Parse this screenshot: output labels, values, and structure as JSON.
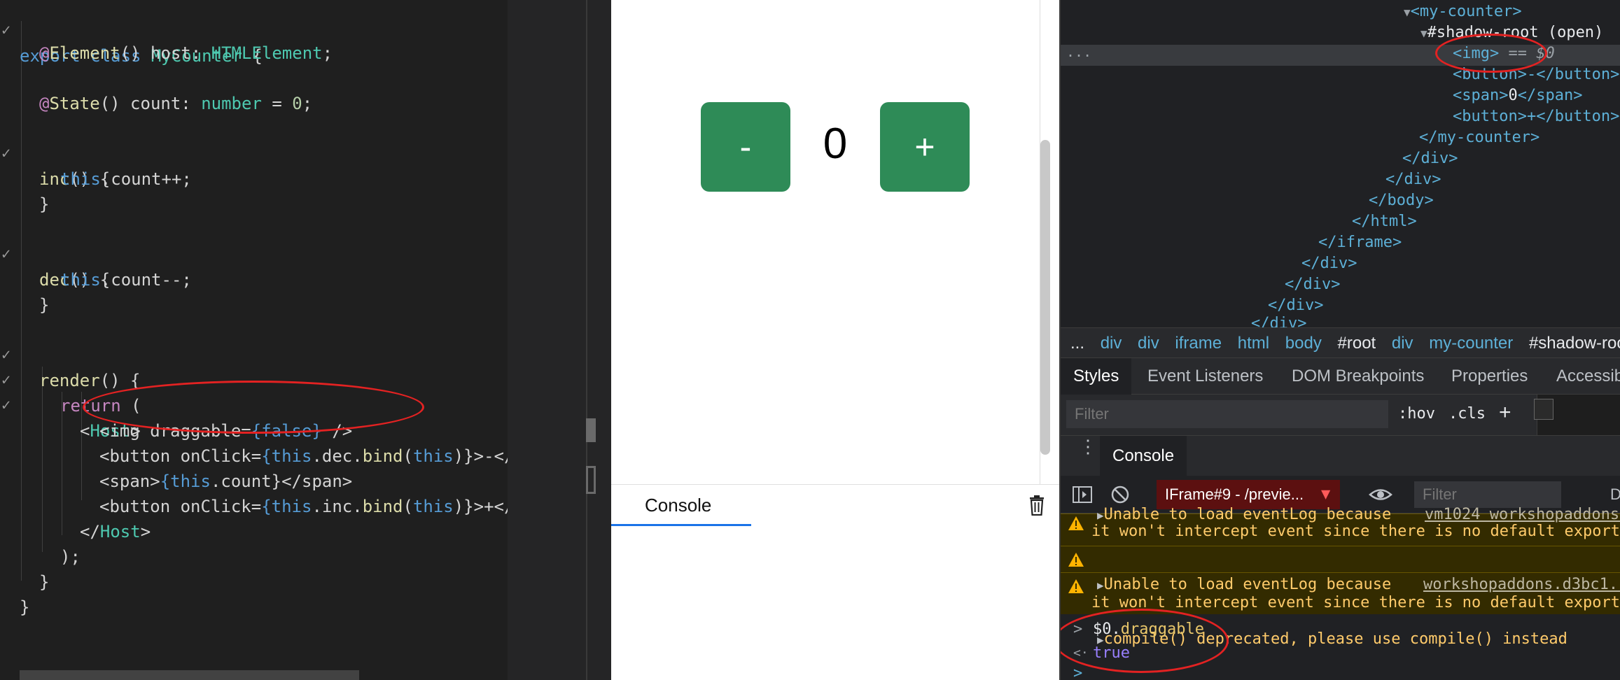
{
  "editor": {
    "lines": {
      "l0_kw": "export class ",
      "l0_cls": "MyCounter",
      "l0_end": " {",
      "l1_at": "@",
      "l1_dec": "Element",
      "l1_rest": "() host: ",
      "l1_type": "HTMLElement",
      "l1_end": ";",
      "l3_at": "@",
      "l3_dec": "State",
      "l3_rest": "() count: ",
      "l3_type": "number",
      "l3_eq": " = ",
      "l3_num": "0",
      "l3_end": ";",
      "l5_fn": "inc",
      "l5_rest": "() {",
      "l6_this": "this",
      "l6_rest": ".count++;",
      "l7": "}",
      "l9_fn": "dec",
      "l9_rest": "() {",
      "l10_this": "this",
      "l10_rest": ".count--;",
      "l11": "}",
      "l13_fn": "render",
      "l13_rest": "() {",
      "l14_kw": "return",
      "l14_rest": " (",
      "l15_open": "<",
      "l15_tag": "Host",
      "l15_close": ">",
      "l16_a": "<img draggable=",
      "l16_b": "{",
      "l16_c": "false",
      "l16_d": "}",
      "l16_e": " />",
      "l17_a": "<button onClick=",
      "l17_b": "{",
      "l17_this": "this",
      "l17_c": ".dec.",
      "l17_bind": "bind",
      "l17_d": "(",
      "l17_this2": "this",
      "l17_e": ")}>-</",
      "l18_a": "<span>",
      "l18_b": "{",
      "l18_this": "this",
      "l18_c": ".count}</span>",
      "l19_a": "<button onClick=",
      "l19_b": "{",
      "l19_this": "this",
      "l19_c": ".inc.",
      "l19_bind": "bind",
      "l19_d": "(",
      "l19_this2": "this",
      "l19_e": ")}>+</",
      "l20_a": "</",
      "l20_tag": "Host",
      "l20_b": ">",
      "l21": ");",
      "l22": "}",
      "l23": "}"
    },
    "fold_marker": "✓"
  },
  "preview": {
    "minus_label": "-",
    "plus_label": "+",
    "count": "0"
  },
  "preview_console": {
    "tab_label": "Console",
    "trash_icon": "trash-icon"
  },
  "devtools": {
    "dom": {
      "my_counter_open": "<my-counter>",
      "shadow_root": "#shadow-root (open)",
      "img_line": "<img>",
      "img_eq": " == ",
      "img_dollar": "$0",
      "button_minus": "<button>-</button>",
      "span_open": "<span>",
      "span_val": "0",
      "span_close": "</span>",
      "button_plus": "<button>+</button>",
      "my_counter_close": "</my-counter>",
      "div_close_1": "</div>",
      "div_close_2": "</div>",
      "body_close": "</body>",
      "html_close": "</html>",
      "iframe_close": "</iframe>",
      "div_close_3": "</div>",
      "div_close_4": "</div>",
      "div_close_5": "</div>",
      "div_close_6": "</div>",
      "dots": "..."
    },
    "breadcrumbs": [
      "...",
      "div",
      "div",
      "iframe",
      "html",
      "body",
      "#root",
      "div",
      "my-counter",
      "#shadow-root"
    ],
    "panel_tabs": [
      "Styles",
      "Event Listeners",
      "DOM Breakpoints",
      "Properties",
      "Accessibility"
    ],
    "filter_placeholder": "Filter",
    "hov": ":hov",
    "cls": ".cls",
    "plus": "+",
    "console_tab": "Console",
    "context_select": "IFrame#9 - /previe...",
    "console_filter_placeholder": "Filter",
    "default_levels": "D",
    "messages": {
      "m1a": "Unable to load eventLog because",
      "m1src": "vm1024 workshopaddons...",
      "m1b": "it won't intercept event since there is no default export",
      "m2": "compile() deprecated, please use compile() instead",
      "m3a": "Unable to load eventLog because",
      "m3src": "workshopaddons.d3bc1...",
      "m3b": "it won't intercept event since there is no default export",
      "expr_obj": "$0.",
      "expr_prop": "draggable",
      "result": "true",
      "prompt_in": ">",
      "prompt_out": "<·"
    }
  },
  "colors": {
    "counter_button": "#2e8b57",
    "annotation": "#e32222",
    "warning_bg": "#332b00"
  }
}
